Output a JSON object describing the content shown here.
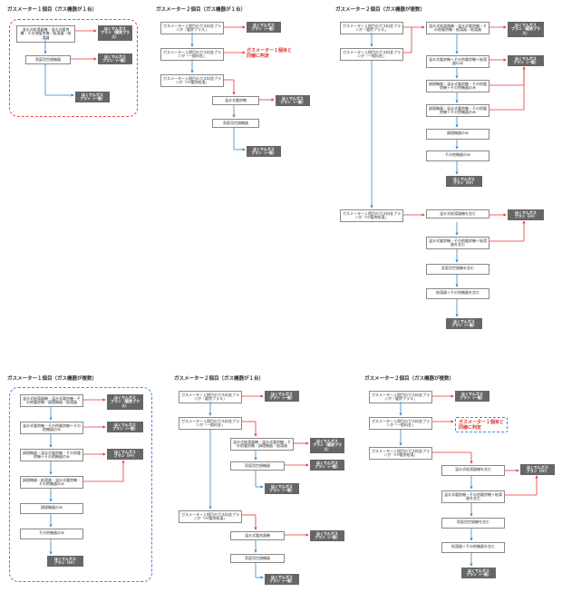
{
  "plans": {
    "danbo": "ほくでんガス\nプラン（暖房プラス）",
    "ippan": "ほくでんガス\nプラン（一般）",
    "ff": "ほくでんガス\nプラン（FF）"
  },
  "notes": {
    "same1": "ガスメーター１個目と\n同様に判定"
  },
  "A": {
    "title": "ガスメーター１個目（ガス機器が１台）",
    "n1": "温水式給湯器機・温水式暖房機・その他暖房機・給湯器・給湯器",
    "n2": "家庭用空調機器"
  },
  "B": {
    "title": "ガスメーター２個目（ガス機器が１台）",
    "q1": "ガスメーター１個目のガス料金プランが「暖房プラス」",
    "q2": "ガスメーター１個目のガス料金プランが「一般料金」",
    "q3": "ガスメーター１個目のガス料金プランが「FF暖房給湯」",
    "n1": "温水式暖房機",
    "n2": "家庭用空調機器"
  },
  "C": {
    "title": "ガスメーター２個目（ガス機器が複数）",
    "q1": "ガスメーター１個目のガス料金プランが「暖房プラス」",
    "q2": "ガスメーター１個目のガス料金プランが「一般料金」",
    "q3": "ガスメーター１個目のガス料金プランが「FF暖房給湯」",
    "r1": "温水式給湯器機・温水式暖房機・その他暖房機・給湯器・給湯器",
    "r2": "温水式暖房機＋その他暖房機＋給湯器のみ",
    "r3": "調理機器・温水式暖房機・その他暖房機＋その他機器のみ",
    "r4": "調理機器・温水式暖房機・その他暖房機＋その他機器のみ",
    "r5": "調理機器のみ",
    "r6": "その他機器のみ",
    "s1": "温水式給湯器機を含む",
    "s2": "温水式暖房機・その他暖房機＋給湯器を含む",
    "s3": "家庭用空調機を含む",
    "s4": "給湯器＋その他機器を含む"
  },
  "D": {
    "title": "ガスメーター１個目（ガス機器が複数）",
    "n1": "温水式給湯器機・温水式暖房機・その他暖房機・調理機器・給湯器",
    "n2": "温水式暖房機・その他暖房機＋その他機器のみ",
    "n3": "調理機器・温水式暖房機・その他暖房機＋その他機器のみ",
    "n4": "調理機器・給湯器・温水式暖房機・その他機器のみ",
    "n5": "調理機器のみ",
    "n6": "その他機器のみ"
  },
  "E": {
    "title": "ガスメーター２個目（ガス機器が１台）",
    "q1": "ガスメーター１個目のガス料金プランが「暖房プラス」",
    "q2": "ガスメーター１個目のガス料金プランが「一般料金」",
    "q3": "ガスメーター１個目のガス料金プランが「FF暖房給湯」",
    "n1": "温水式給湯器機・温水式暖房機・その他暖房機・調理機器・給湯器",
    "n2": "家庭用空調機器",
    "n3": "温水式暖房器機",
    "n4": "家庭用空調機器"
  },
  "F": {
    "title": "ガスメーター２個目（ガス機器が複数）",
    "q1": "ガスメーター１個目のガス料金プランが「暖房プラス」",
    "q2": "ガスメーター１個目のガス料金プランが「一般料金」",
    "q3": "ガスメーター１個目のガス料金プランが「FF暖房給湯」",
    "s1": "温水式給湯器機を含む",
    "s2": "温水式暖房機・その他暖房機＋給湯器を含む",
    "s3": "家庭用空調機を含む",
    "s4": "給湯器＋その他機器を含む"
  }
}
